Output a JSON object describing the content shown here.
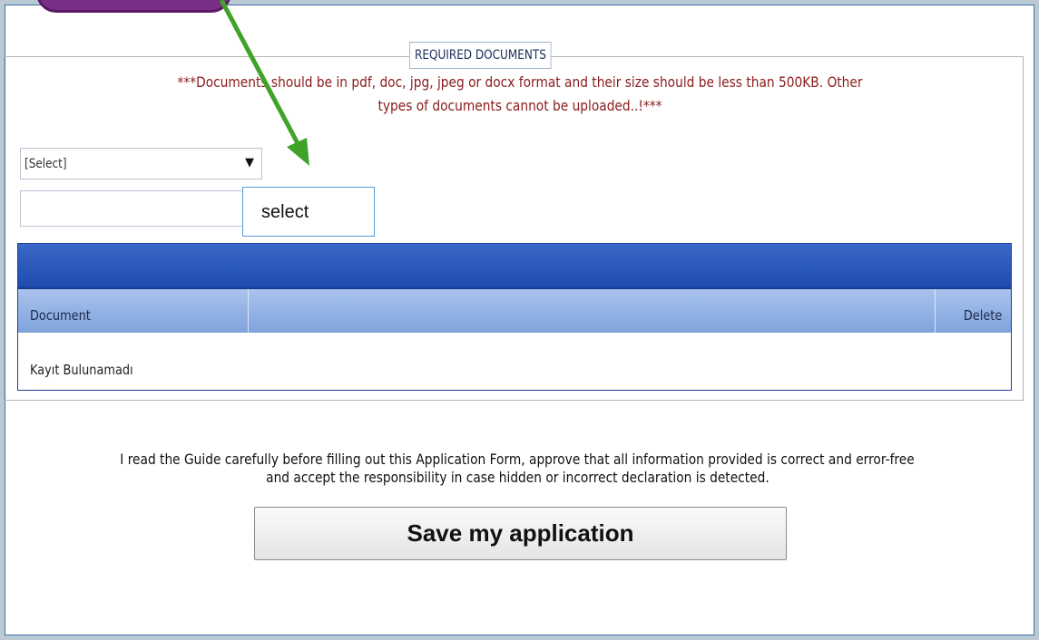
{
  "fieldset": {
    "legend": "REQUIRED DOCUMENTS",
    "warning_line1": "***Documents should be in pdf, doc, jpg, jpeg or docx format and their size should be less than 500KB. Other",
    "warning_line2": "types of documents cannot be uploaded..!***"
  },
  "document_type_select": {
    "selected": "[Select]",
    "icon": "chevron-down-icon"
  },
  "file_input": {
    "value": ""
  },
  "select_button": {
    "label": "select"
  },
  "documents_grid": {
    "columns": [
      "Document",
      "",
      "Delete"
    ],
    "empty_message": "Kayıt Bulunamadı",
    "header_color": "#2a57bd"
  },
  "declaration": {
    "line1": "I read the Guide carefully before filling out this Application Form, approve that all information provided is correct and error-free",
    "line2": "and accept the responsibility in case hidden or incorrect declaration is detected."
  },
  "save_button": {
    "label": "Save my application"
  },
  "annotation": {
    "arrow_color": "#3fa32a",
    "shape_color": "#7a2f86"
  }
}
